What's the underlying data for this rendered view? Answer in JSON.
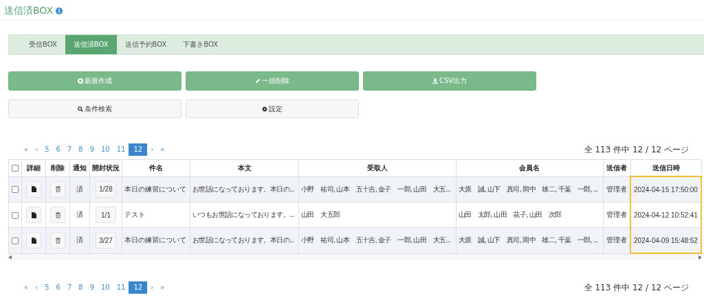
{
  "page": {
    "title": "送信済BOX"
  },
  "tabs": [
    {
      "label": "受信BOX",
      "selected": false
    },
    {
      "label": "送信済BOX",
      "selected": true
    },
    {
      "label": "送信予約BOX",
      "selected": false
    },
    {
      "label": "下書きBOX",
      "selected": false
    }
  ],
  "actions": [
    {
      "label": "新規作成",
      "kind": "primary"
    },
    {
      "label": "一括削除",
      "kind": "primary"
    },
    {
      "label": "CSV出力",
      "kind": "primary"
    },
    {
      "label": "条件検索",
      "kind": "default"
    },
    {
      "label": "設定",
      "kind": "default"
    }
  ],
  "pagination_top": {
    "pages": [
      {
        "label": "«",
        "selected": false
      },
      {
        "label": "‹",
        "selected": false
      },
      {
        "label": "5",
        "selected": false
      },
      {
        "label": "6",
        "selected": false
      },
      {
        "label": "7",
        "selected": false
      },
      {
        "label": "8",
        "selected": false
      },
      {
        "label": "9",
        "selected": false
      },
      {
        "label": "10",
        "selected": false
      },
      {
        "label": "11",
        "selected": false
      },
      {
        "label": "12",
        "selected": true
      },
      {
        "label": "›",
        "selected": false
      },
      {
        "label": "»",
        "selected": false
      }
    ],
    "info": "全 113 件中 12 / 12 ページ"
  },
  "table": {
    "select_all": {
      "checked": false
    },
    "columns": [
      {
        "label": "詳細",
        "highlighted": false
      },
      {
        "label": "削除",
        "highlighted": false
      },
      {
        "label": "通知",
        "highlighted": false
      },
      {
        "label": "開封状況",
        "highlighted": false
      },
      {
        "label": "件名",
        "highlighted": false
      },
      {
        "label": "本文",
        "highlighted": false
      },
      {
        "label": "受取人",
        "highlighted": false
      },
      {
        "label": "会員名",
        "highlighted": false
      },
      {
        "label": "送信者",
        "highlighted": false
      },
      {
        "label": "送信日時",
        "highlighted": true
      }
    ],
    "rows": [
      {
        "checked": false,
        "notified": "済",
        "opened": "1/28",
        "subject": "本日の練習について",
        "body": "お世話になっております。本日の...",
        "recipients": "小野　祐司, 山本　五十吉, 金子　一郎, 山田　大五...",
        "members": "大原　誠, 山下　真司, 岡中　雄二, 千葉　一郎, ...",
        "sender": "管理者",
        "sent_at": "2024-04-15 17:50:00"
      },
      {
        "checked": false,
        "notified": "済",
        "opened": "1/1",
        "subject": "テスト",
        "body": "いつもお世話になっております。...",
        "recipients": "山田　大五郎",
        "members": "山田　太郎, 山田　花子, 山田　次郎",
        "sender": "管理者",
        "sent_at": "2024-04-12 10:52:41"
      },
      {
        "checked": false,
        "notified": "済",
        "opened": "3/27",
        "subject": "本日の練習について",
        "body": "お世話になっております。本日の...",
        "recipients": "小野　祐司, 山本　五十吉, 金子　一郎, 山田　大五...",
        "members": "大原　誠, 山下　真司, 岡中　雄二, 千葉　一郎, ...",
        "sender": "管理者",
        "sent_at": "2024-04-09 15:48:52"
      }
    ]
  },
  "pagination_bottom": {
    "pages": [
      {
        "label": "«",
        "selected": false
      },
      {
        "label": "‹",
        "selected": false
      },
      {
        "label": "5",
        "selected": false
      },
      {
        "label": "6",
        "selected": false
      },
      {
        "label": "7",
        "selected": false
      },
      {
        "label": "8",
        "selected": false
      },
      {
        "label": "9",
        "selected": false
      },
      {
        "label": "10",
        "selected": false
      },
      {
        "label": "11",
        "selected": false
      },
      {
        "label": "12",
        "selected": true
      },
      {
        "label": "›",
        "selected": false
      },
      {
        "label": "»",
        "selected": false
      }
    ],
    "info": "全 113 件中 12 / 12 ページ"
  }
}
